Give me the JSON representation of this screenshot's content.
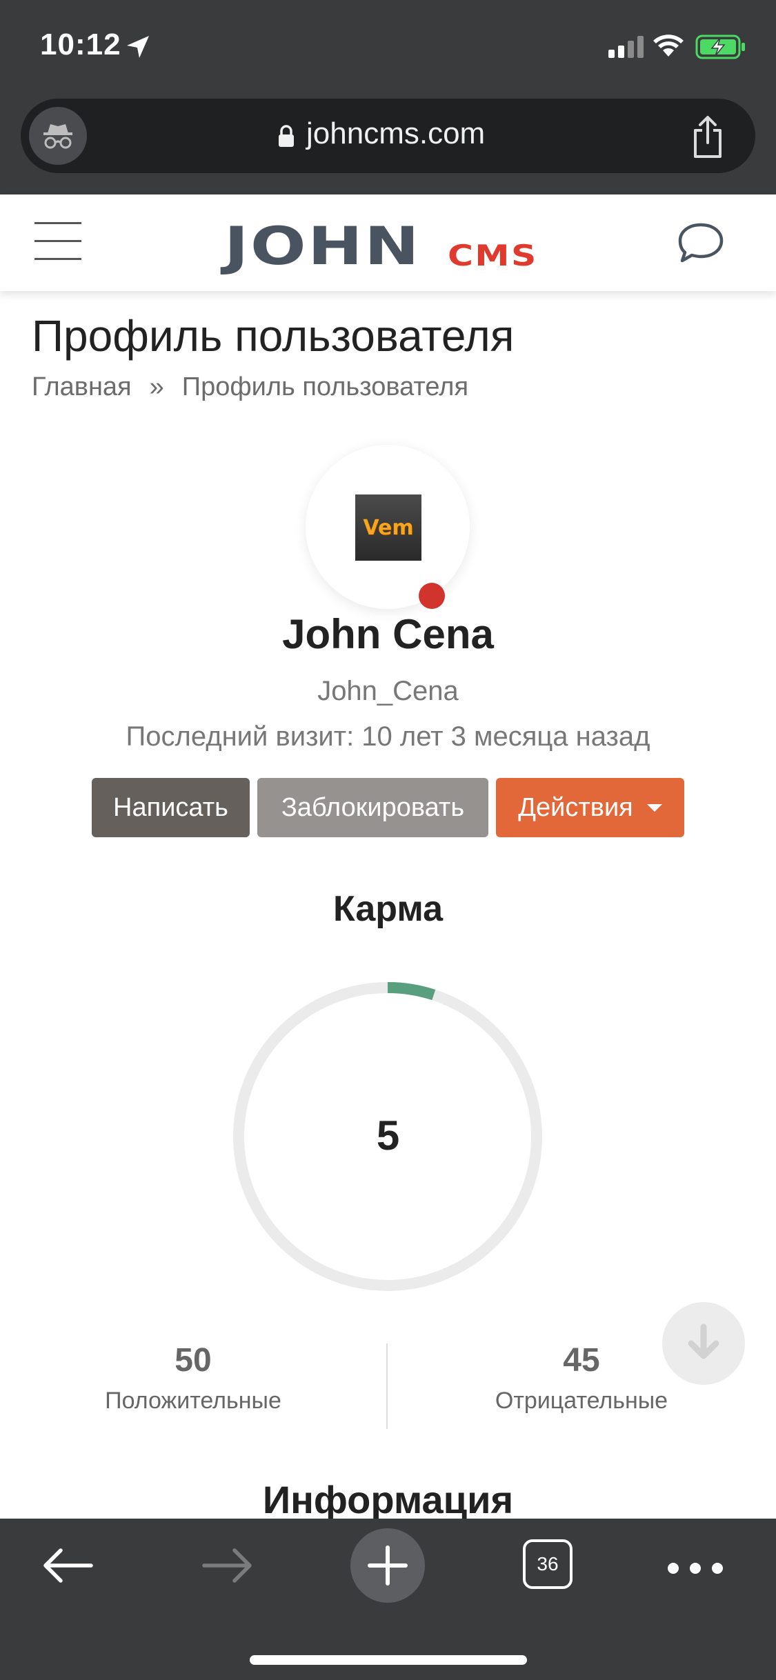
{
  "status_bar": {
    "time": "10:12"
  },
  "browser": {
    "url": "johncms.com",
    "tab_count": "36"
  },
  "site": {
    "logo_main": "JOHN",
    "logo_sub": "cms"
  },
  "page": {
    "title": "Профиль пользователя",
    "breadcrumb": [
      {
        "label": "Главная"
      },
      {
        "label": "Профиль пользователя"
      }
    ],
    "breadcrumb_separator": "»"
  },
  "profile": {
    "avatar_text": "Vem",
    "name": "John Cena",
    "login": "John_Cena",
    "last_visit": "Последний визит: 10 лет 3 месяца назад",
    "online_status_color": "#d0342c",
    "buttons": {
      "write": "Написать",
      "block": "Заблокировать",
      "actions": "Действия"
    }
  },
  "karma": {
    "title": "Карма",
    "value": "5",
    "progress_fraction": 0.05,
    "positive_count": "50",
    "positive_label": "Положительные",
    "negative_count": "45",
    "negative_label": "Отрицательные",
    "progress_color": "#5a9e80",
    "track_color": "#ebebeb"
  },
  "info": {
    "title": "Информация"
  },
  "colors": {
    "btn_write": "#65605b",
    "btn_block": "#959290",
    "btn_actions": "#e2683a",
    "logo_cms": "#e03a2f",
    "chrome_bg": "#3a3b3d"
  }
}
